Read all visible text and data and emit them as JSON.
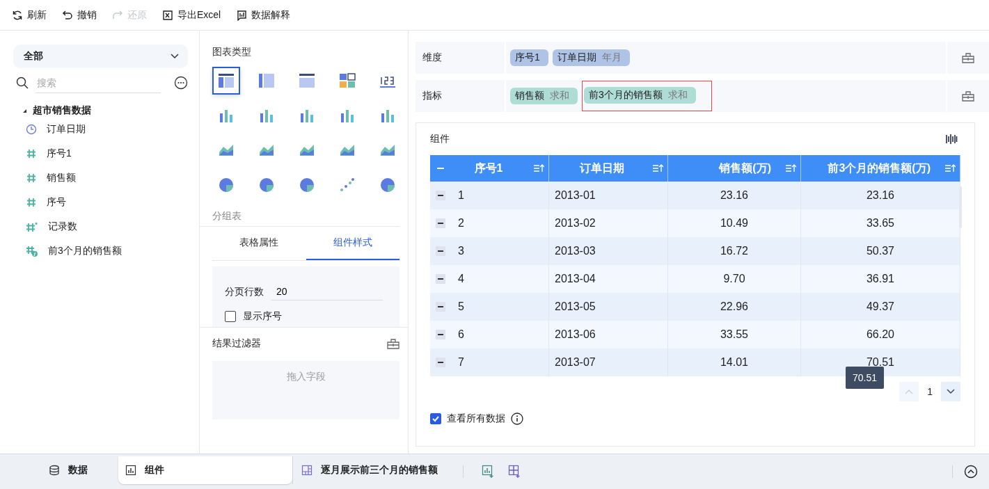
{
  "toolbar": [
    {
      "kind": "refresh",
      "label": "刷新",
      "disabled": false
    },
    {
      "kind": "undo",
      "label": "撤销",
      "disabled": false
    },
    {
      "kind": "redo",
      "label": "还原",
      "disabled": true
    },
    {
      "kind": "excel",
      "label": "导出Excel",
      "disabled": false
    },
    {
      "kind": "explain",
      "label": "数据解释",
      "disabled": false
    }
  ],
  "data_panel": {
    "dropdown": "全部",
    "search": {
      "placeholder": "搜索"
    },
    "dataset": {
      "name": "超市销售数据",
      "expanded": true,
      "fields": [
        {
          "kind": "date",
          "label": "订单日期"
        },
        {
          "kind": "number",
          "label": "序号1"
        },
        {
          "kind": "number",
          "label": "销售额"
        },
        {
          "kind": "number",
          "label": "序号"
        },
        {
          "kind": "count",
          "label": "记录数"
        },
        {
          "kind": "calc",
          "label": "前3个月的销售额"
        }
      ]
    }
  },
  "chart_panel": {
    "title": "图表类型",
    "chart_types": [
      {
        "selected": true
      },
      {
        "selected": false
      },
      {
        "selected": false
      },
      {
        "selected": false
      },
      {
        "selected": false
      },
      {
        "selected": false
      },
      {
        "selected": false
      },
      {
        "selected": false
      },
      {
        "selected": false
      },
      {
        "selected": false
      },
      {
        "selected": false
      },
      {
        "selected": false
      },
      {
        "selected": false
      },
      {
        "selected": false
      },
      {
        "selected": false
      },
      {
        "selected": false
      },
      {
        "selected": false
      },
      {
        "selected": false
      },
      {
        "selected": false
      },
      {
        "selected": false
      }
    ],
    "chart_name": "分组表",
    "tabs": [
      {
        "label": "表格属性",
        "selected": false
      },
      {
        "label": "组件样式",
        "selected": true
      }
    ],
    "rows_per_page": {
      "label": "分页行数",
      "value": "20"
    },
    "show_index": {
      "label": "显示序号",
      "checked": false
    },
    "filter": {
      "title": "结果过滤器",
      "placeholder": "拖入字段"
    }
  },
  "shelves": [
    {
      "label": "维度",
      "pills": [
        {
          "kind": "dimension",
          "name": "序号1",
          "highlighted": false
        },
        {
          "kind": "dimension",
          "name": "订单日期",
          "agg": "年月",
          "highlighted": false
        }
      ]
    },
    {
      "label": "指标",
      "pills": [
        {
          "kind": "measure",
          "name": "销售额",
          "agg": "求和",
          "highlighted": false
        },
        {
          "kind": "measure",
          "name": "前3个月的销售额",
          "agg": "求和",
          "highlighted": true
        }
      ]
    }
  ],
  "component": {
    "title": "组件",
    "table": {
      "columns": [
        "序号1",
        "订单日期",
        "销售额(万)",
        "前3个月的销售额(万)"
      ],
      "rows": [
        [
          "1",
          "2013-01",
          "23.16",
          "23.16"
        ],
        [
          "2",
          "2013-02",
          "10.49",
          "33.65"
        ],
        [
          "3",
          "2013-03",
          "16.72",
          "50.37"
        ],
        [
          "4",
          "2013-04",
          "9.70",
          "36.91"
        ],
        [
          "5",
          "2013-05",
          "22.96",
          "49.37"
        ],
        [
          "6",
          "2013-06",
          "33.55",
          "66.20"
        ],
        [
          "7",
          "2013-07",
          "14.01",
          "70.51"
        ]
      ]
    },
    "tooltip": "70.51",
    "page": "1",
    "view_all": {
      "label": "查看所有数据",
      "checked": true
    }
  },
  "bottom_tabs": [
    {
      "kind": "data",
      "label": "数据",
      "selected": false
    },
    {
      "kind": "component",
      "label": "组件",
      "selected": true
    },
    {
      "kind": "dashboard",
      "label": "逐月展示前三个月的销售额",
      "selected": false
    }
  ]
}
